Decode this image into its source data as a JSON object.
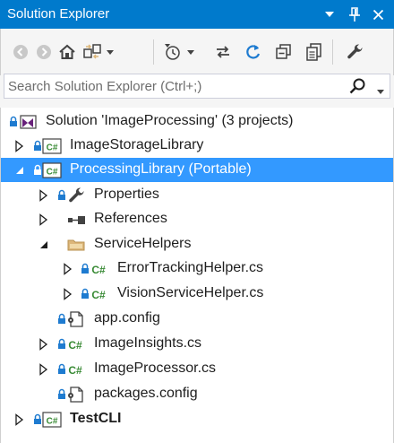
{
  "window": {
    "title": "Solution Explorer"
  },
  "search": {
    "placeholder": "Search Solution Explorer (Ctrl+;)"
  },
  "colors": {
    "accent": "#007acc",
    "selection": "#3399ff",
    "csharp_green": "#388a34",
    "folder": "#dcb67a"
  },
  "tree": {
    "solution": "Solution 'ImageProcessing' (3 projects)",
    "image_storage_library": "ImageStorageLibrary",
    "processing_library": "ProcessingLibrary (Portable)",
    "properties": "Properties",
    "references": "References",
    "service_helpers": "ServiceHelpers",
    "error_tracking_helper": "ErrorTrackingHelper.cs",
    "vision_service_helper": "VisionServiceHelper.cs",
    "app_config": "app.config",
    "image_insights": "ImageInsights.cs",
    "image_processor": "ImageProcessor.cs",
    "packages_config": "packages.config",
    "test_cli": "TestCLI"
  }
}
